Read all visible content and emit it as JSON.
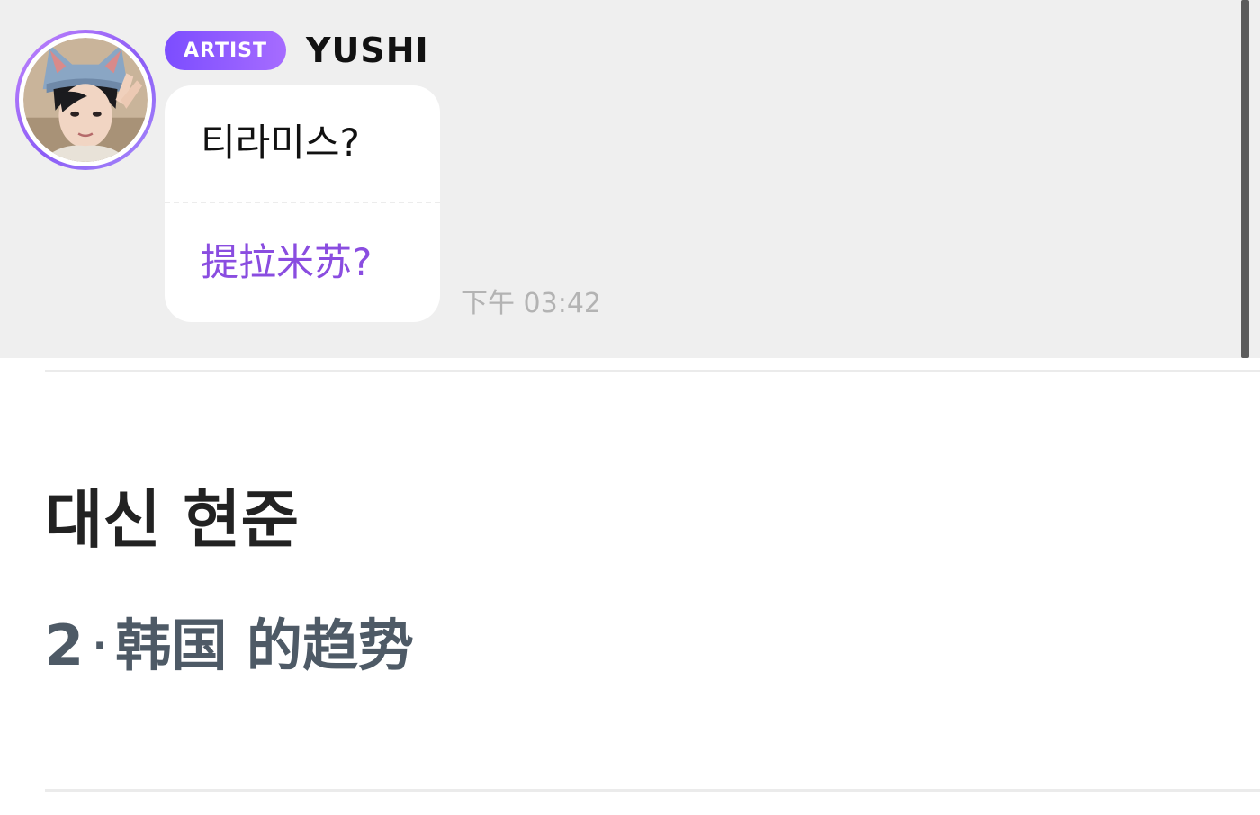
{
  "chat": {
    "badge": "ARTIST",
    "artist_name": "YUSHI",
    "message_original": "티라미스?",
    "message_translation": "提拉米苏?",
    "time": "下午 03:42",
    "avatar_icon": "artist-avatar-photo",
    "colors": {
      "badge_start": "#7c4dff",
      "badge_end": "#a66cff",
      "translation": "#8a4de0",
      "panel_bg": "#efefef"
    }
  },
  "trend": {
    "title": "대신 현준",
    "rank": "2",
    "separator": "·",
    "category": "韩国 的趋势"
  }
}
